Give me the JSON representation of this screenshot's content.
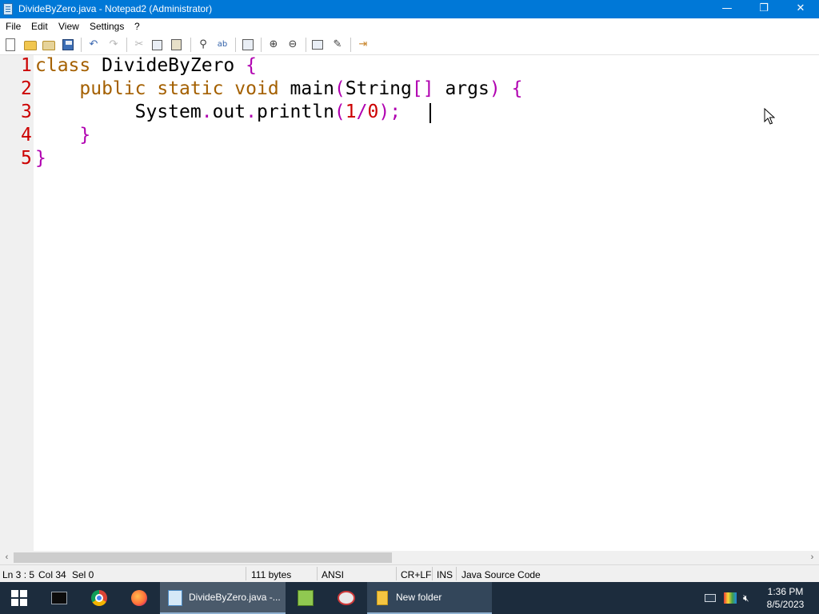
{
  "window": {
    "title": "DivideByZero.java - Notepad2 (Administrator)",
    "buttons": {
      "minimize": "—",
      "maximize": "❐",
      "close": "✕"
    }
  },
  "menu": [
    "File",
    "Edit",
    "View",
    "Settings",
    "?"
  ],
  "toolbar": {
    "icons": [
      "new-file-icon",
      "open-folder-icon",
      "browse-icon",
      "save-icon",
      "undo-icon",
      "redo-icon",
      "cut-icon",
      "copy-icon",
      "paste-icon",
      "find-icon",
      "replace-icon",
      "wordwrap-icon",
      "zoom-in-icon",
      "zoom-out-icon",
      "scheme-icon",
      "customize-icon",
      "exit-icon"
    ]
  },
  "editor": {
    "line_numbers": [
      "1",
      "2",
      "3",
      "4",
      "5"
    ],
    "lines": [
      [
        {
          "t": "class",
          "c": "kw"
        },
        {
          "t": " DivideByZero ",
          "c": ""
        },
        {
          "t": "{",
          "c": "br"
        }
      ],
      [
        {
          "t": "    ",
          "c": ""
        },
        {
          "t": "public",
          "c": "kw"
        },
        {
          "t": " ",
          "c": ""
        },
        {
          "t": "static",
          "c": "kw"
        },
        {
          "t": " ",
          "c": ""
        },
        {
          "t": "void",
          "c": "kw"
        },
        {
          "t": " main",
          "c": ""
        },
        {
          "t": "(",
          "c": "br"
        },
        {
          "t": "String",
          "c": ""
        },
        {
          "t": "[]",
          "c": "br"
        },
        {
          "t": " args",
          "c": ""
        },
        {
          "t": ")",
          "c": "br"
        },
        {
          "t": " ",
          "c": ""
        },
        {
          "t": "{",
          "c": "br"
        }
      ],
      [
        {
          "t": "         System",
          "c": ""
        },
        {
          "t": ".",
          "c": "br"
        },
        {
          "t": "out",
          "c": ""
        },
        {
          "t": ".",
          "c": "br"
        },
        {
          "t": "println",
          "c": ""
        },
        {
          "t": "(",
          "c": "br"
        },
        {
          "t": "1",
          "c": "lit"
        },
        {
          "t": "/",
          "c": "br"
        },
        {
          "t": "0",
          "c": "lit"
        },
        {
          "t": ");",
          "c": "br"
        }
      ],
      [
        {
          "t": "    ",
          "c": ""
        },
        {
          "t": "}",
          "c": "br"
        }
      ],
      [
        {
          "t": "}",
          "c": "br"
        }
      ]
    ],
    "colors": {
      "keyword": "#a46000",
      "operator": "#b000b0",
      "number": "#cc0000",
      "line_number": "#cc0000"
    }
  },
  "statusbar": {
    "position": "Ln 3 : 5",
    "column": "Col 34",
    "selection": "Sel 0",
    "size": "111 bytes",
    "encoding": "ANSI",
    "line_ending": "CR+LF",
    "mode": "INS",
    "scheme": "Java Source Code"
  },
  "taskbar": {
    "items": [
      {
        "name": "command-prompt",
        "label": ""
      },
      {
        "name": "chrome",
        "label": ""
      },
      {
        "name": "firefox",
        "label": ""
      },
      {
        "name": "notepad2",
        "label": "DivideByZero.java -..."
      },
      {
        "name": "notepad-pp",
        "label": ""
      },
      {
        "name": "paint",
        "label": ""
      },
      {
        "name": "file-explorer",
        "label": "New folder"
      }
    ],
    "clock": {
      "time": "1:36 PM",
      "date": "8/5/2023"
    }
  }
}
